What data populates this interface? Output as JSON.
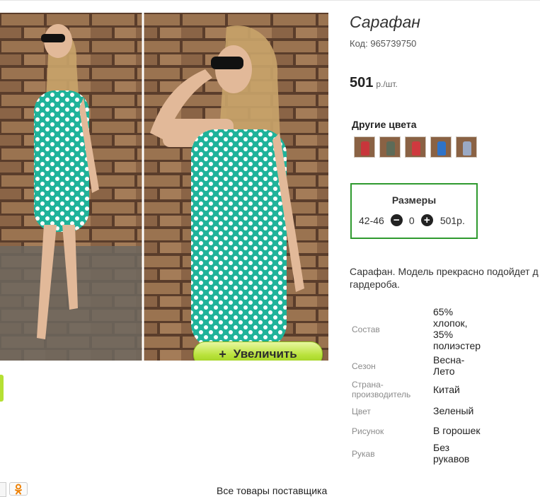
{
  "product": {
    "title": "Сарафан",
    "code_label": "Код:",
    "code": "965739750",
    "price": "501",
    "price_unit": "р./шт."
  },
  "photo": {
    "zoom_label": "Увеличить",
    "zoom_icon": "plus-icon"
  },
  "colors": {
    "title": "Другие цвета",
    "swatches": [
      {
        "color": "#c8363b"
      },
      {
        "color": "#5d6b58"
      },
      {
        "color": "#cf3a3f"
      },
      {
        "color": "#2f73c8"
      },
      {
        "color": "#9aa9c4"
      }
    ]
  },
  "sizes": {
    "title": "Размеры",
    "size": "42-46",
    "quantity": "0",
    "price": "501р.",
    "border_color": "#2f9a2f"
  },
  "description": {
    "line1": "Сарафан. Модель прекрасно подойдет д",
    "line2": "гардероба."
  },
  "specs": [
    {
      "key": "Состав",
      "value_lines": [
        "65%",
        "хлопок,",
        "35%",
        "полиэстер"
      ]
    },
    {
      "key": "Сезон",
      "value_lines": [
        "Весна-",
        "Лето"
      ]
    },
    {
      "key_lines": [
        "Страна-",
        "производитель"
      ],
      "value_lines": [
        "Китай"
      ]
    },
    {
      "key": "Цвет",
      "value_lines": [
        "Зеленый"
      ]
    },
    {
      "key": "Рисунок",
      "value_lines": [
        "В горошек"
      ]
    },
    {
      "key": "Рукав",
      "value_lines": [
        "Без",
        "рукавов"
      ]
    }
  ],
  "footer": {
    "all_products_link": "Все товары поставщика"
  },
  "accent_color": "#b5e033"
}
